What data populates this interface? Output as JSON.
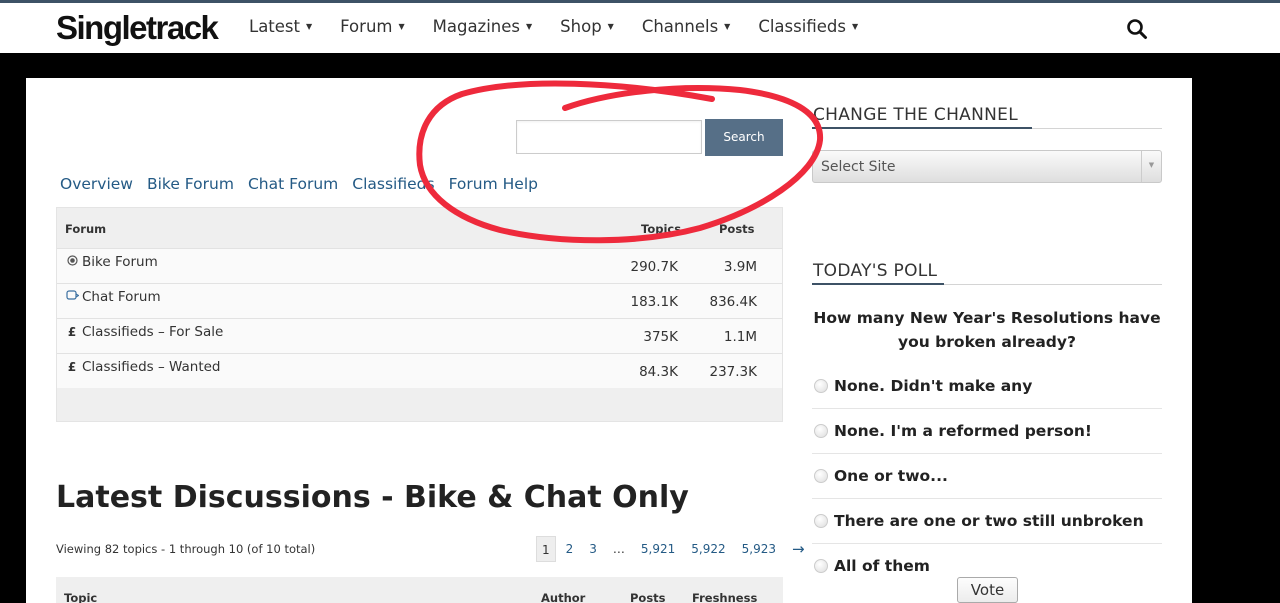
{
  "header": {
    "logo": "Singletrack",
    "nav": [
      {
        "label": "Latest"
      },
      {
        "label": "Forum"
      },
      {
        "label": "Magazines"
      },
      {
        "label": "Shop"
      },
      {
        "label": "Channels"
      },
      {
        "label": "Classifieds"
      }
    ],
    "search_icon": "search-icon"
  },
  "forum_search": {
    "input_value": "",
    "button_label": "Search"
  },
  "tabs": [
    "Overview",
    "Bike Forum",
    "Chat Forum",
    "Classifieds",
    "Forum Help"
  ],
  "forum_table": {
    "headers": {
      "forum": "Forum",
      "topics": "Topics",
      "posts": "Posts"
    },
    "rows": [
      {
        "icon": "bike-icon",
        "name": "Bike Forum",
        "topics": "290.7K",
        "posts": "3.9M"
      },
      {
        "icon": "chat-icon",
        "name": "Chat Forum",
        "topics": "183.1K",
        "posts": "836.4K"
      },
      {
        "icon": "pound-icon",
        "name": "Classifieds – For Sale",
        "topics": "375K",
        "posts": "1.1M"
      },
      {
        "icon": "pound-icon",
        "name": "Classifieds – Wanted",
        "topics": "84.3K",
        "posts": "237.3K"
      }
    ]
  },
  "latest": {
    "title": "Latest Discussions - Bike & Chat Only",
    "viewing": "Viewing 82 topics - 1 through 10 (of 10 total)",
    "pages": [
      "1",
      "2",
      "3",
      "…",
      "5,921",
      "5,922",
      "5,923"
    ],
    "current_page": "1",
    "next_label": "→",
    "headers": {
      "topic": "Topic",
      "author": "Author",
      "posts": "Posts",
      "freshness": "Freshness"
    }
  },
  "sidebar": {
    "channel": {
      "heading": "CHANGE THE CHANNEL",
      "select_value": "Select Site"
    },
    "poll": {
      "heading": "TODAY'S POLL",
      "question": "How many New Year's Resolutions have you broken already?",
      "options": [
        "None. Didn't make any",
        "None. I'm a reformed person!",
        "One or two...",
        "There are one or two still unbroken",
        "All of them"
      ],
      "vote_label": "Vote"
    }
  },
  "colors": {
    "accent": "#566f87",
    "link": "#245a85",
    "annotation": "#ee2a3c"
  }
}
